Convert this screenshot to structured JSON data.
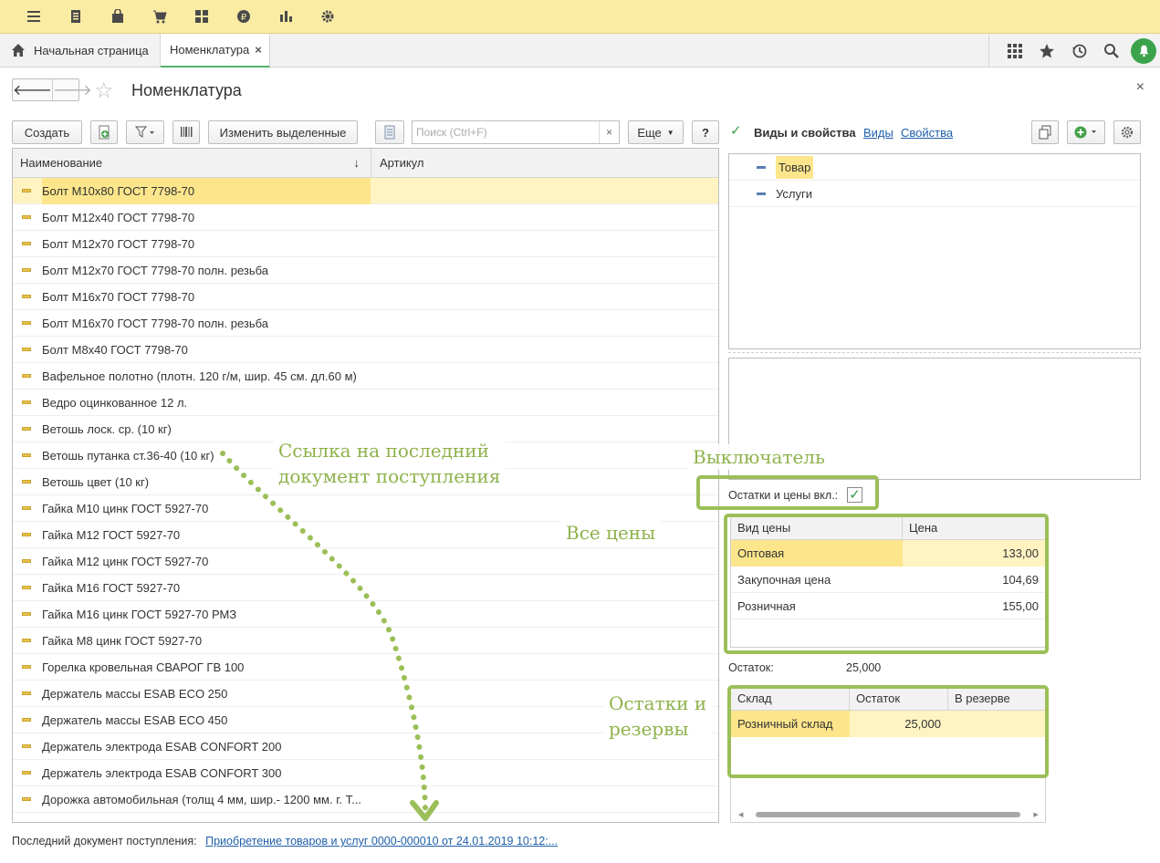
{
  "tabs": {
    "home_label": "Начальная страница",
    "active_label": "Номенклатура",
    "close_glyph": "×"
  },
  "page": {
    "title": "Номенклатура",
    "close_glyph": "×"
  },
  "toolbar": {
    "create_label": "Создать",
    "change_selected_label": "Изменить выделенные",
    "search_placeholder": "Поиск (Ctrl+F)",
    "search_clear_glyph": "×",
    "more_label": "Еще",
    "help_label": "?"
  },
  "grid": {
    "col_name": "Наименование",
    "col_article": "Артикул",
    "sort_glyph": "↓",
    "rows": [
      "Болт М10х80 ГОСТ 7798-70",
      "Болт М12х40 ГОСТ 7798-70",
      "Болт М12х70 ГОСТ 7798-70",
      "Болт М12х70 ГОСТ 7798-70 полн. резьба",
      "Болт М16х70 ГОСТ 7798-70",
      "Болт М16х70 ГОСТ 7798-70 полн. резьба",
      "Болт М8х40 ГОСТ 7798-70",
      "Вафельное полотно (плотн. 120 г/м, шир. 45 см. дл.60 м)",
      "Ведро оцинкованное 12 л.",
      "Ветошь лоск. ср. (10 кг)",
      "Ветошь путанка ст.36-40 (10 кг)",
      "Ветошь цвет (10 кг)",
      "Гайка М10 цинк ГОСТ 5927-70",
      "Гайка М12 ГОСТ 5927-70",
      "Гайка М12 цинк ГОСТ 5927-70",
      "Гайка М16 ГОСТ 5927-70",
      "Гайка М16 цинк ГОСТ 5927-70 РМЗ",
      "Гайка М8 цинк ГОСТ 5927-70",
      "Горелка кровельная СВАРОГ ГВ 100",
      "Держатель массы ESAB ECO 250",
      "Держатель массы ESAB ECO 450",
      "Держатель электрода  ESAB CONFORT 200",
      "Держатель электрода ESAB CONFORT 300",
      "Дорожка автомобильная (толщ 4 мм, шир.- 1200 мм. г. Т..."
    ]
  },
  "last_doc": {
    "label": "Последний документ поступления:",
    "link": "Приобретение товаров и услуг 0000-000010 от 24.01.2019 10:12:..."
  },
  "right": {
    "views_label": "Виды и свойства",
    "views_link": "Виды",
    "props_link": "Свойства",
    "tree": [
      "Товар",
      "Услуги"
    ],
    "switch_label": "Остатки и цены вкл.:",
    "switch_check": "✓",
    "views_check": "✓",
    "prices": {
      "col_type": "Вид цены",
      "col_price": "Цена",
      "rows": [
        {
          "type": "Оптовая",
          "price": "133,00"
        },
        {
          "type": "Закупочная цена",
          "price": "104,69"
        },
        {
          "type": "Розничная",
          "price": "155,00"
        }
      ]
    },
    "balance_label": "Остаток:",
    "balance_value": "25,000",
    "stock": {
      "col_wh": "Склад",
      "col_bal": "Остаток",
      "col_res": "В резерве",
      "rows": [
        {
          "wh": "Розничный склад",
          "bal": "25,000",
          "res": ""
        }
      ]
    }
  },
  "annotations": {
    "link_note_line1": "Ссылка на последний",
    "link_note_line2": "документ поступления",
    "switch_note": "Выключатель",
    "prices_note": "Все цены",
    "stock_note_line1": "Остатки и",
    "stock_note_line2": "резервы",
    "color": "#9bbf58"
  }
}
